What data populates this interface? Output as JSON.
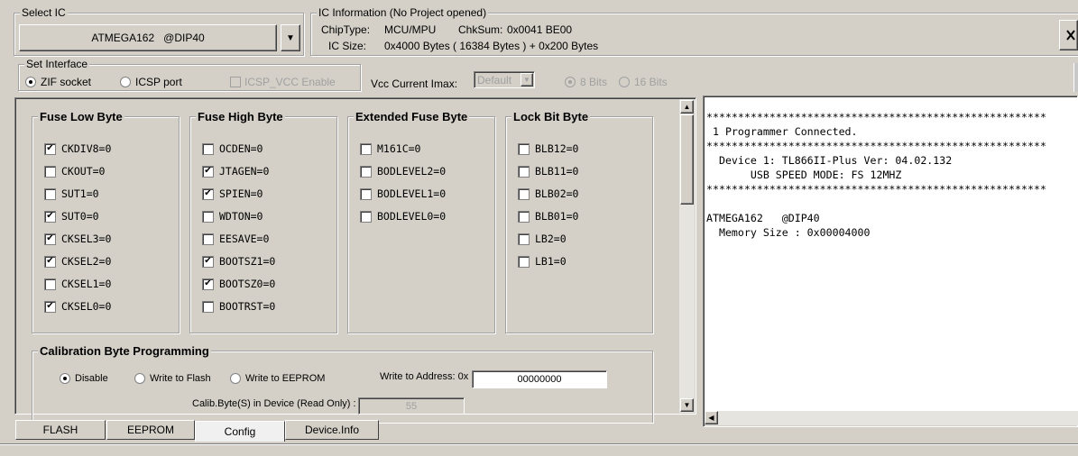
{
  "select_ic": {
    "title": "Select IC",
    "value": "ATMEGA162   @DIP40",
    "dropdown_glyph": "▼"
  },
  "ic_info": {
    "title": "IC Information (No Project opened)",
    "chip_type_label": "ChipType:",
    "chip_type_value": "MCU/MPU",
    "chksum_label": "ChkSum:",
    "chksum_value": "0x0041 BE00",
    "ic_size_label": "IC Size:",
    "ic_size_value": "0x4000 Bytes ( 16384 Bytes ) + 0x200 Bytes"
  },
  "set_interface": {
    "title": "Set Interface",
    "zif_label": "ZIF socket",
    "zif_selected": true,
    "icsp_label": "ICSP port",
    "icsp_vcc_label": "ICSP_VCC Enable"
  },
  "vcc": {
    "label": "Vcc Current Imax:",
    "value": "Default",
    "bits8_label": "8 Bits",
    "bits16_label": "16 Bits"
  },
  "fuse_low": {
    "title": "Fuse Low Byte",
    "items": [
      {
        "label": "CKDIV8=0",
        "checked": "✔"
      },
      {
        "label": "CKOUT=0",
        "checked": ""
      },
      {
        "label": "SUT1=0",
        "checked": ""
      },
      {
        "label": "SUT0=0",
        "checked": "✔"
      },
      {
        "label": "CKSEL3=0",
        "checked": "✔"
      },
      {
        "label": "CKSEL2=0",
        "checked": "✔"
      },
      {
        "label": "CKSEL1=0",
        "checked": ""
      },
      {
        "label": "CKSEL0=0",
        "checked": "✔"
      }
    ]
  },
  "fuse_high": {
    "title": "Fuse High Byte",
    "items": [
      {
        "label": "OCDEN=0",
        "checked": ""
      },
      {
        "label": "JTAGEN=0",
        "checked": "✔"
      },
      {
        "label": "SPIEN=0",
        "checked": "✔"
      },
      {
        "label": "WDTON=0",
        "checked": ""
      },
      {
        "label": "EESAVE=0",
        "checked": ""
      },
      {
        "label": "BOOTSZ1=0",
        "checked": "✔"
      },
      {
        "label": "BOOTSZ0=0",
        "checked": "✔"
      },
      {
        "label": "BOOTRST=0",
        "checked": ""
      }
    ]
  },
  "ext_fuse": {
    "title": "Extended Fuse Byte",
    "items": [
      {
        "label": "M161C=0",
        "checked": ""
      },
      {
        "label": "BODLEVEL2=0",
        "checked": ""
      },
      {
        "label": "BODLEVEL1=0",
        "checked": ""
      },
      {
        "label": "BODLEVEL0=0",
        "checked": ""
      }
    ]
  },
  "lock_bits": {
    "title": "Lock Bit Byte",
    "items": [
      {
        "label": "BLB12=0",
        "checked": ""
      },
      {
        "label": "BLB11=0",
        "checked": ""
      },
      {
        "label": "BLB02=0",
        "checked": ""
      },
      {
        "label": "BLB01=0",
        "checked": ""
      },
      {
        "label": "LB2=0",
        "checked": ""
      },
      {
        "label": "LB1=0",
        "checked": ""
      }
    ]
  },
  "calibration": {
    "title": "Calibration Byte Programming",
    "disable_label": "Disable",
    "write_flash_label": "Write to Flash",
    "write_eeprom_label": "Write to EEPROM",
    "address_label": "Write to Address: 0x",
    "address_value": "00000000",
    "calib_label": "Calib.Byte(S) in Device (Read Only) :",
    "calib_value": "55"
  },
  "tabs": [
    "FLASH",
    "EEPROM",
    "Config",
    "Device.Info"
  ],
  "log": {
    "lines": [
      "******************************************************",
      " 1 Programmer Connected.",
      "******************************************************",
      "  Device 1: TL866II-Plus Ver: 04.02.132",
      "       USB SPEED MODE: FS 12MHZ",
      "******************************************************",
      "",
      "ATMEGA162   @DIP40",
      "  Memory Size : 0x00004000"
    ]
  },
  "colors": {
    "face": "#d4d0c8",
    "window": "#ffffff",
    "disabled_text": "#a0a0a0"
  }
}
